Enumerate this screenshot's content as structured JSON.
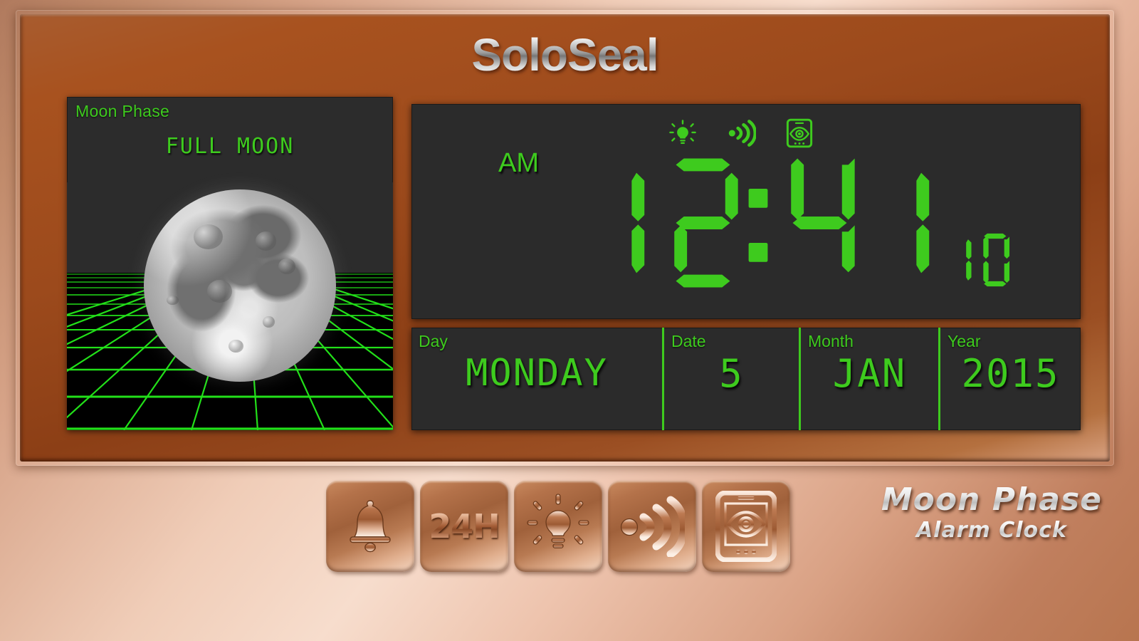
{
  "app": {
    "title": "SoloSeal",
    "logo_line1": "Moon Phase",
    "logo_line2": "Alarm Clock"
  },
  "colors": {
    "lcd_green": "#3ecb1e",
    "panel_bg": "#2b2b2b",
    "frame_copper": "#9c4a1c",
    "background_copper": "#d9a184"
  },
  "moon_panel": {
    "label": "Moon Phase",
    "phase": "FULL MOON"
  },
  "clock": {
    "meridiem": "AM",
    "hours": "12",
    "minutes": "41",
    "seconds": "10",
    "colon": ":",
    "status_icons": [
      {
        "name": "brightness-icon",
        "label": "Brightness",
        "active": true
      },
      {
        "name": "sound-icon",
        "label": "Sound",
        "active": true
      },
      {
        "name": "display-eye-icon",
        "label": "Display",
        "active": true
      }
    ]
  },
  "date_panel": {
    "cells": [
      {
        "key": "day",
        "label": "Day",
        "value": "MONDAY"
      },
      {
        "key": "date",
        "label": "Date",
        "value": "5"
      },
      {
        "key": "month",
        "label": "Month",
        "value": "JAN"
      },
      {
        "key": "year",
        "label": "Year",
        "value": "2015"
      }
    ]
  },
  "toolbar": {
    "buttons": [
      {
        "name": "alarm-button",
        "icon": "bell-icon",
        "label": "Alarm"
      },
      {
        "name": "time-format-button",
        "icon": "24h-icon",
        "label": "24H"
      },
      {
        "name": "brightness-button",
        "icon": "bulb-icon",
        "label": "Brightness"
      },
      {
        "name": "sound-button",
        "icon": "sound-wave-icon",
        "label": "Sound"
      },
      {
        "name": "display-button",
        "icon": "screen-eye-icon",
        "label": "Display"
      }
    ]
  }
}
